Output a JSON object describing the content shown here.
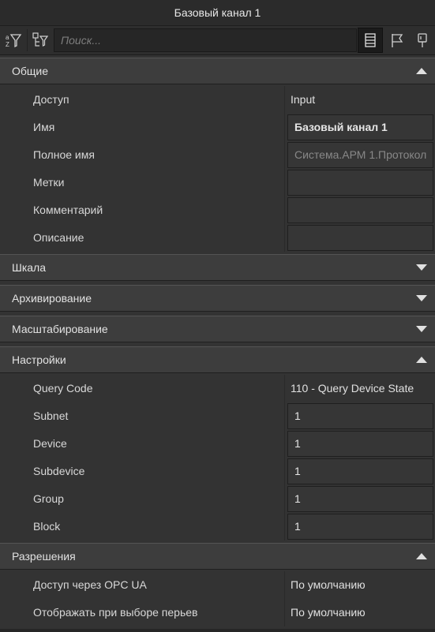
{
  "window": {
    "title": "Базовый канал 1"
  },
  "toolbar": {
    "filter_icon": "sort-filter-icon",
    "tree_icon": "tree-filter-icon",
    "search_placeholder": "Поиск...",
    "list_view_icon": "list-view-icon",
    "flag_icon": "flag-icon",
    "pin_icon": "pin-icon"
  },
  "sections": {
    "general": {
      "label": "Общие",
      "expanded": true,
      "rows": [
        {
          "name": "Доступ",
          "value": "Input"
        },
        {
          "name": "Имя",
          "value": "Базовый канал 1"
        },
        {
          "name": "Полное имя",
          "value": "Система.АРМ 1.Протокол"
        },
        {
          "name": "Метки",
          "value": ""
        },
        {
          "name": "Комментарий",
          "value": ""
        },
        {
          "name": "Описание",
          "value": ""
        }
      ]
    },
    "scale": {
      "label": "Шкала",
      "expanded": false
    },
    "archiving": {
      "label": "Архивирование",
      "expanded": false
    },
    "scaling": {
      "label": "Масштабирование",
      "expanded": false
    },
    "settings": {
      "label": "Настройки",
      "expanded": true,
      "rows": [
        {
          "name": "Query Code",
          "value": "110 - Query Device State"
        },
        {
          "name": "Subnet",
          "value": "1"
        },
        {
          "name": "Device",
          "value": "1"
        },
        {
          "name": "Subdevice",
          "value": "1"
        },
        {
          "name": "Group",
          "value": "1"
        },
        {
          "name": "Block",
          "value": "1"
        }
      ]
    },
    "permissions": {
      "label": "Разрешения",
      "expanded": true,
      "rows": [
        {
          "name": "Доступ через OPC UA",
          "value": "По умолчанию"
        },
        {
          "name": "Отображать при выборе перьев",
          "value": "По умолчанию"
        }
      ]
    }
  }
}
